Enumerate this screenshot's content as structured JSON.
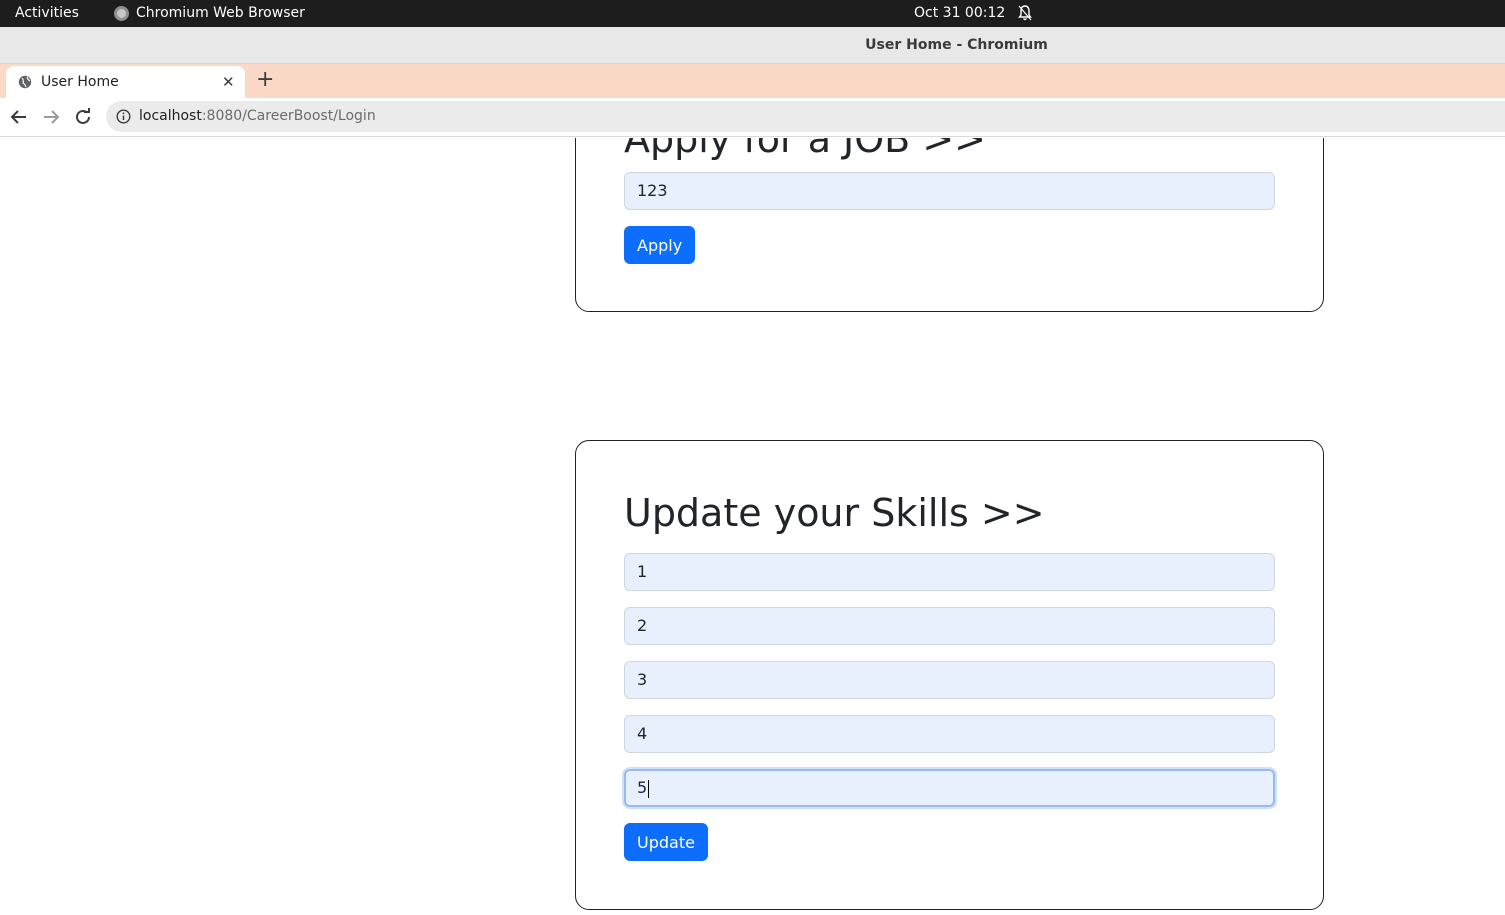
{
  "system_bar": {
    "activities": "Activities",
    "app_name": "Chromium Web Browser",
    "clock": "Oct 31  00:12"
  },
  "window": {
    "title": "User Home - Chromium"
  },
  "tabs": [
    {
      "title": "User Home",
      "active": true
    }
  ],
  "address_bar": {
    "host": "localhost",
    "path": ":8080/CareerBoost/Login"
  },
  "apply_section": {
    "heading": "Apply for a JOB >>",
    "job_id_value": "123",
    "button_label": "Apply"
  },
  "skills_section": {
    "heading": "Update your Skills >>",
    "skills": [
      "1",
      "2",
      "3",
      "4",
      "5"
    ],
    "button_label": "Update"
  },
  "colors": {
    "primary_button": "#0d6efd",
    "field_background": "#e8f0fe",
    "tab_strip": "#fcd9c6"
  }
}
